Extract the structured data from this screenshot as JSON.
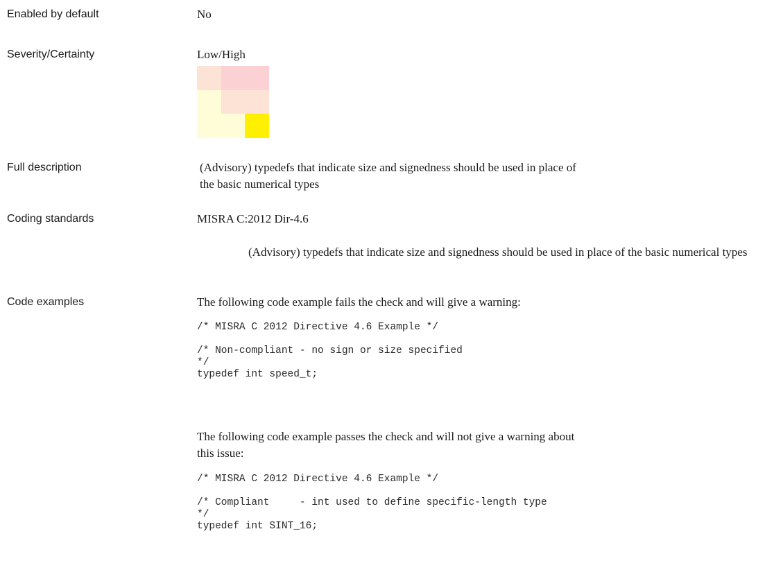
{
  "rows": {
    "enabled": {
      "label": "Enabled by default",
      "value": "No"
    },
    "severity": {
      "label": "Severity/Certainty",
      "value": "Low/High",
      "matrix_colors": [
        [
          "#fde2d6",
          "#fcd1d4",
          "#fcd1d4"
        ],
        [
          "#fefdd7",
          "#fde2d6",
          "#fde2d6"
        ],
        [
          "#fefdd7",
          "#fefdd7",
          "#ffef00"
        ]
      ]
    },
    "full_description": {
      "label": "Full description",
      "text": "(Advisory) typedefs that indicate size and signedness should be used in place of the basic numerical types"
    },
    "coding_standards": {
      "label": "Coding standards",
      "standard": "MISRA C:2012 Dir-4.6",
      "detail": "(Advisory) typedefs that indicate size and signedness should be used in place of the basic numerical types"
    },
    "code_examples": {
      "label": "Code examples",
      "fail_intro": "The following code example fails the check and will give a warning:",
      "fail_code": "/* MISRA C 2012 Directive 4.6 Example */\n\n/* Non-compliant - no sign or size specified\n*/\ntypedef int speed_t;",
      "pass_intro": "The following code example passes the check and will not give a warning about this issue:",
      "pass_code": "/* MISRA C 2012 Directive 4.6 Example */\n\n/* Compliant     - int used to define specific-length type\n*/\ntypedef int SINT_16;"
    }
  }
}
